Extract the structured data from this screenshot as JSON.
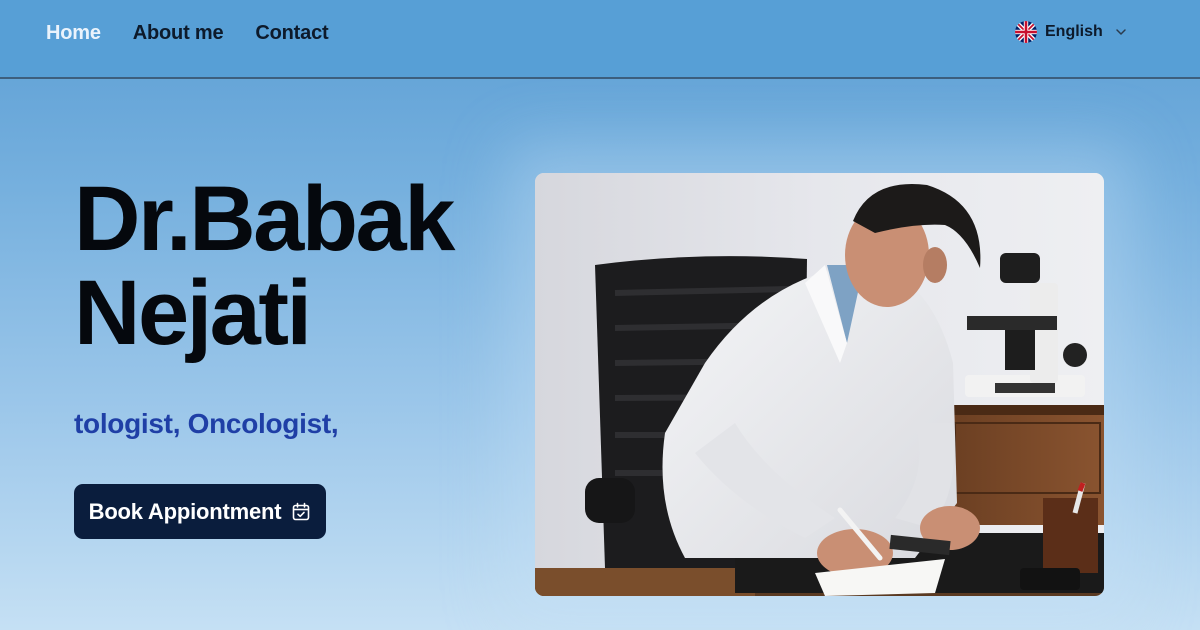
{
  "nav": {
    "items": [
      {
        "label": "Home",
        "active": true
      },
      {
        "label": "About me",
        "active": false
      },
      {
        "label": "Contact",
        "active": false
      }
    ]
  },
  "language": {
    "label": "English",
    "flag_icon": "uk-flag-icon",
    "chevron_icon": "chevron-down-icon"
  },
  "hero": {
    "title_line1": "Dr.Babak",
    "title_line2": "Nejati",
    "subtitle": "tologist, Oncologist,",
    "cta_label": "Book Appiontment",
    "cta_icon": "calendar-check-icon"
  },
  "colors": {
    "header_bg": "#579fd6",
    "title": "#05080d",
    "subtitle": "#1f3fa6",
    "cta_bg": "#0a1d3d"
  }
}
